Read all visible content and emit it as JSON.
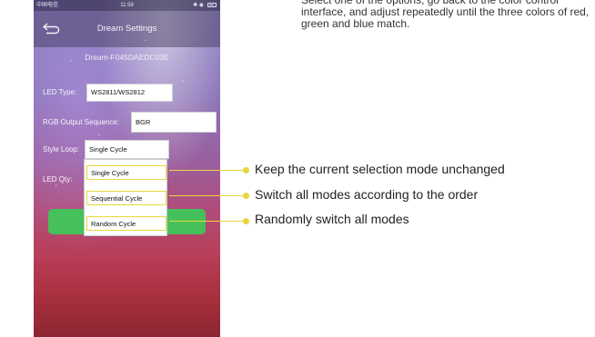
{
  "phone": {
    "status_bar": {
      "carrier": "中国电信 ",
      "time": "11:59",
      "icons": "✱ ◉"
    },
    "nav": {
      "title": "Dream Settings",
      "back_icon": "back-arrow-icon"
    },
    "device_name": "Dream-F045DAEDC03E",
    "settings": {
      "led_type": {
        "label": "LED Type:",
        "value": "WS2811/WS2812"
      },
      "rgb_output_sequence": {
        "label": "RGB Output Sequence:",
        "value": "BGR"
      },
      "style_loop": {
        "label": "Style Loop:",
        "value": "Single Cycle"
      },
      "led_qty": {
        "label": "LED Qty:"
      }
    },
    "dropdown": {
      "options": [
        "Single Cycle",
        "Sequential Cycle",
        "Random Cycle"
      ]
    },
    "colors": {
      "ok_button": "#46c05a",
      "highlight": "#e8d640"
    }
  },
  "annotations": {
    "top_note": "Select one of the options, go back to the color control interface, and adjust repeatedly until the three colors of red, green and blue match.",
    "callouts": [
      "Keep the current selection mode unchanged",
      "Switch all modes according to the order",
      "Randomly switch all modes"
    ]
  }
}
